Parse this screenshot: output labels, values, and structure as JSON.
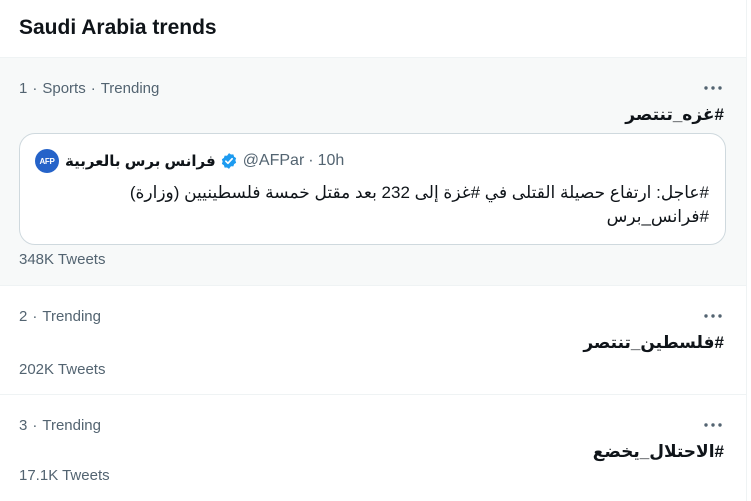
{
  "header": {
    "title": "Saudi Arabia trends"
  },
  "trends": [
    {
      "rank": "1",
      "category": "Sports",
      "status": "Trending",
      "hashtag": "#غزه_تنتصر",
      "tweet_count": "348K Tweets",
      "card": {
        "avatar_text": "AFP",
        "display_name": "فرانس برس بالعربية",
        "handle": "@AFPar",
        "time": "10h",
        "text": "#عاجل: ارتفاع حصيلة القتلى في #غزة إلى 232 بعد مقتل خمسة فلسطينيين (وزارة) #فرانس_برس"
      }
    },
    {
      "rank": "2",
      "status": "Trending",
      "hashtag": "#فلسطين_تنتصر",
      "tweet_count": "202K Tweets"
    },
    {
      "rank": "3",
      "status": "Trending",
      "hashtag": "#الاحتلال_يخضع",
      "tweet_count": "17.1K Tweets"
    }
  ],
  "icons": {
    "more": "more-horizontal-icon",
    "verified": "verified-badge-icon"
  },
  "colors": {
    "accent": "#1d9bf0",
    "secondary_text": "#536471",
    "primary_text": "#0f1419",
    "highlight_bg": "#f7f9f9",
    "avatar_bg": "#2563c9"
  }
}
